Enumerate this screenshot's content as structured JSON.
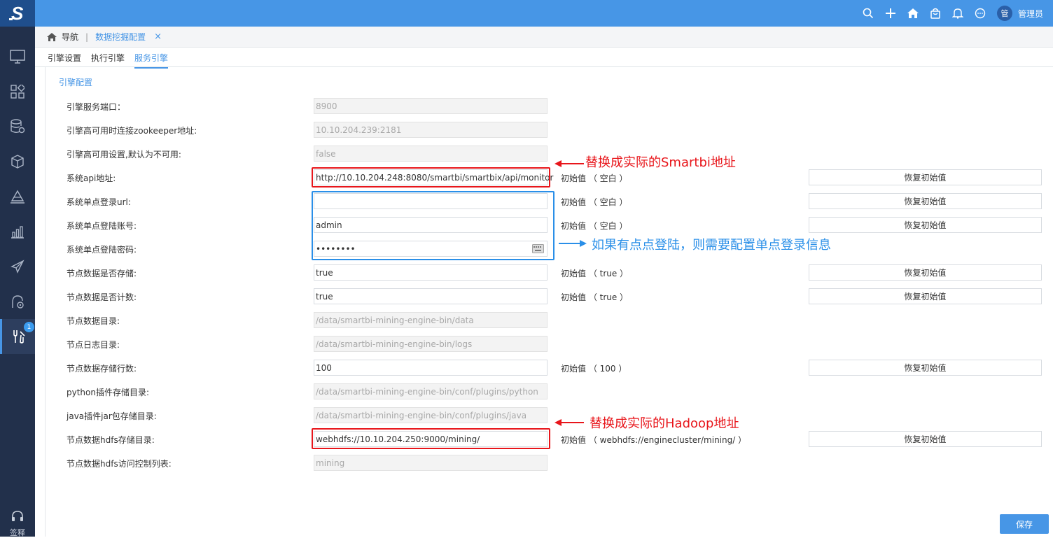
{
  "header": {
    "username": "管理员",
    "avatar_text": "管",
    "icons": [
      "search-icon",
      "plus-icon",
      "home-icon",
      "bag-icon",
      "bell-icon",
      "chat-icon"
    ]
  },
  "sidebar": {
    "badge_count": "1",
    "bottom_label": "签释"
  },
  "breadcrumb": {
    "nav": "导航",
    "tab": "数据挖掘配置",
    "close": "×"
  },
  "tabs": [
    {
      "label": "引擎设置"
    },
    {
      "label": "执行引擎"
    },
    {
      "label": "服务引擎"
    }
  ],
  "section_title": "引擎配置",
  "rows": [
    {
      "label": "引擎服务端口：",
      "value": "8900",
      "disabled": true
    },
    {
      "label": "引擎高可用时连接zookeeper地址:",
      "value": "10.10.204.239:2181",
      "disabled": true
    },
    {
      "label": "引擎高可用设置,默认为不可用:",
      "value": "false",
      "disabled": true
    },
    {
      "label": "系统api地址:",
      "value": "http://10.10.204.248:8080/smartbi/smartbix/api/monitor",
      "init": "初始值 （ 空白 ）",
      "reset": "恢复初始值"
    },
    {
      "label": "系统单点登录url:",
      "value": "",
      "init": "初始值 （ 空白 ）",
      "reset": "恢复初始值"
    },
    {
      "label": "系统单点登陆账号:",
      "value": "admin",
      "init": "初始值 （ 空白 ）",
      "reset": "恢复初始值"
    },
    {
      "label": "系统单点登陆密码:",
      "value": "••••••••"
    },
    {
      "label": "节点数据是否存储:",
      "value": "true",
      "init": "初始值 （ true ）",
      "reset": "恢复初始值"
    },
    {
      "label": "节点数据是否计数:",
      "value": "true",
      "init": "初始值 （ true ）",
      "reset": "恢复初始值"
    },
    {
      "label": "节点数据目录:",
      "value": "/data/smartbi-mining-engine-bin/data",
      "disabled": true
    },
    {
      "label": "节点日志目录:",
      "value": "/data/smartbi-mining-engine-bin/logs",
      "disabled": true
    },
    {
      "label": "节点数据存储行数:",
      "value": "100",
      "init": "初始值 （ 100 ）",
      "reset": "恢复初始值"
    },
    {
      "label": "python插件存储目录:",
      "value": "/data/smartbi-mining-engine-bin/conf/plugins/python",
      "disabled": true
    },
    {
      "label": "java插件jar包存储目录:",
      "value": "/data/smartbi-mining-engine-bin/conf/plugins/java",
      "disabled": true
    },
    {
      "label": "节点数据hdfs存储目录:",
      "value": "webhdfs://10.10.204.250:9000/mining/",
      "init": "初始值 （ webhdfs://enginecluster/mining/ ）",
      "reset": "恢复初始值"
    },
    {
      "label": "节点数据hdfs访问控制列表:",
      "value": "mining",
      "disabled": true
    }
  ],
  "annotations": {
    "smartbi": "替换成实际的Smartbi地址",
    "sso": "如果有点点登陆，则需要配置单点登录信息",
    "hadoop": "替换成实际的Hadoop地址"
  },
  "save_label": "保存",
  "colors": {
    "topbar": "#4796e6",
    "sidebar": "#22304b",
    "accent": "#4796e6",
    "annotation_red": "#e8161b",
    "annotation_blue": "#2a8fe8"
  }
}
